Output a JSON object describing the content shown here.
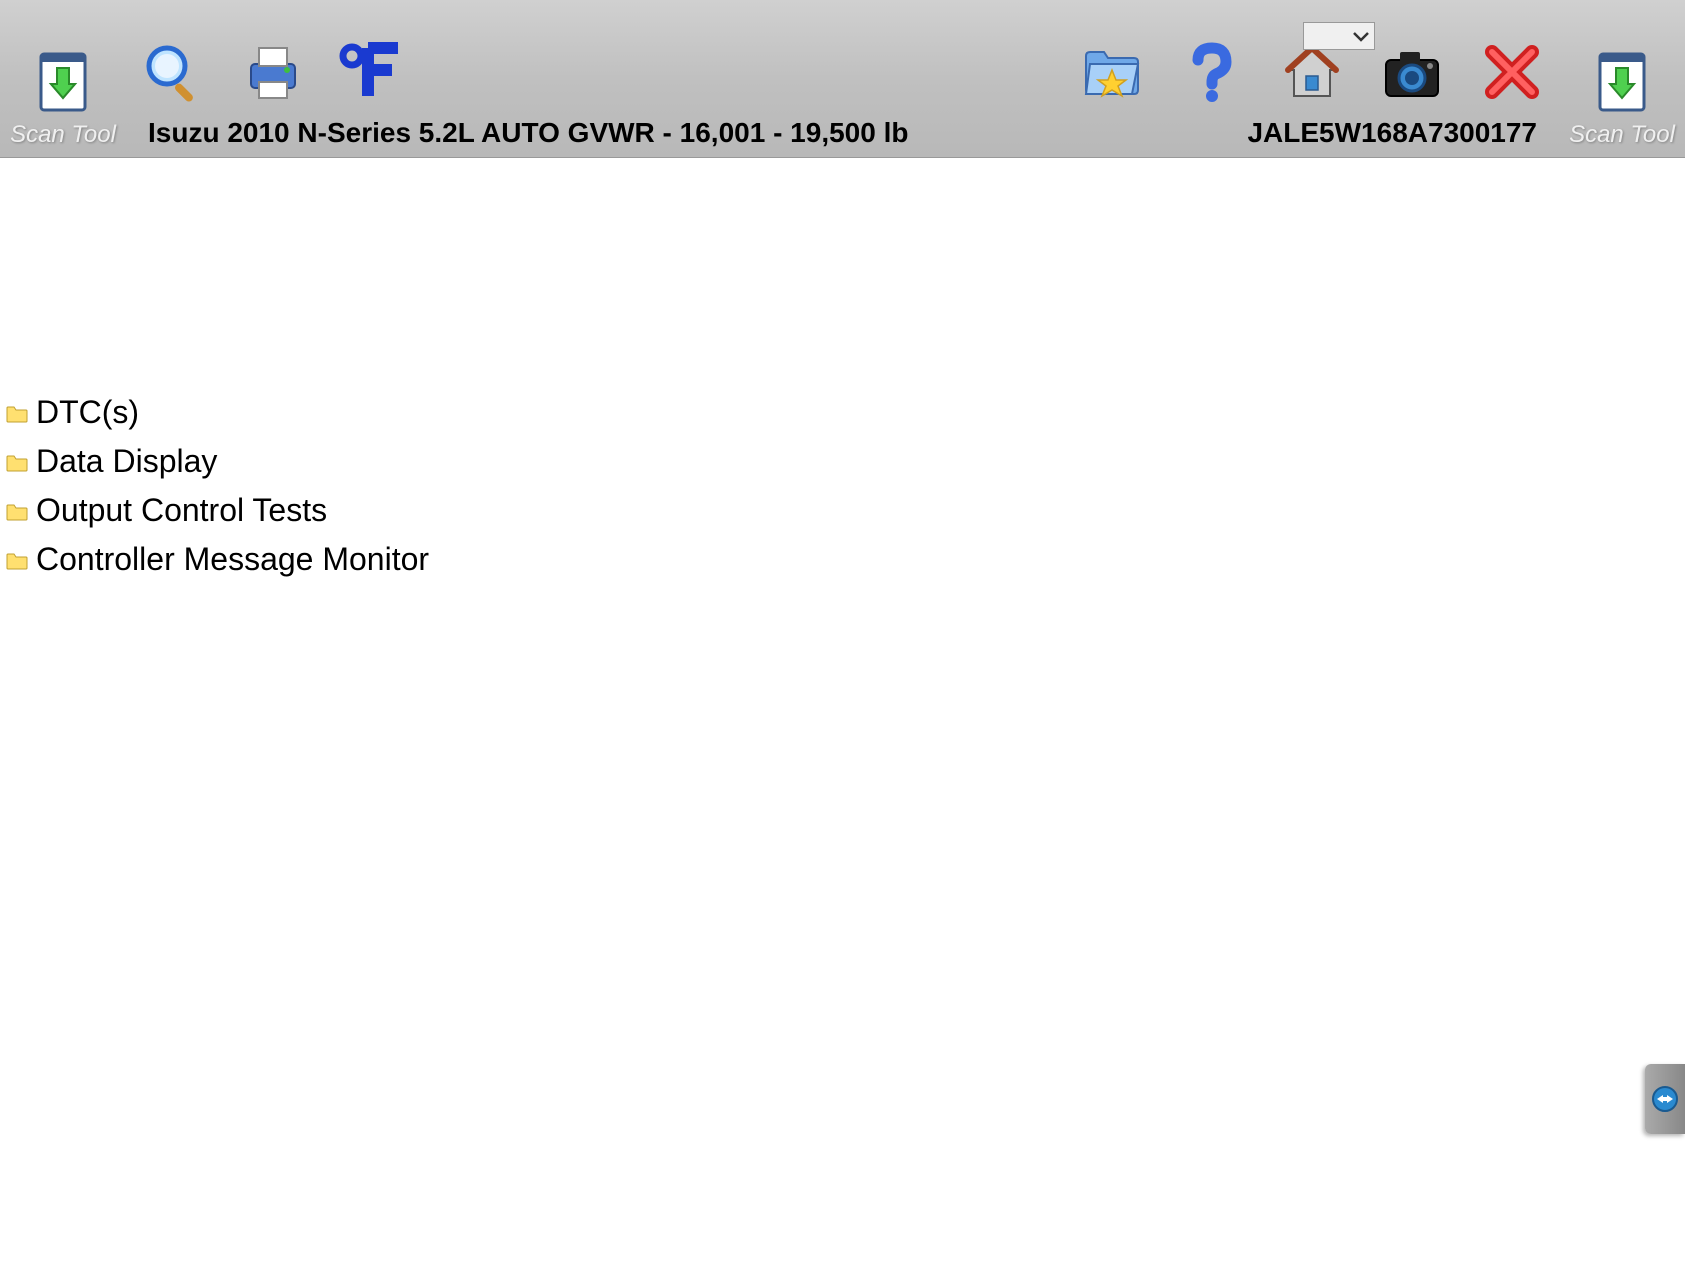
{
  "toolbar": {
    "left_label": "Scan Tool",
    "right_label": "Scan Tool",
    "vehicle_info": "Isuzu  2010  N-Series  5.2L  AUTO GVWR - 16,001 - 19,500 lb",
    "vin": "JALE5W168A7300177"
  },
  "menu": {
    "items": [
      {
        "label": "DTC(s)"
      },
      {
        "label": "Data Display"
      },
      {
        "label": "Output Control Tests"
      },
      {
        "label": "Controller Message Monitor"
      }
    ]
  }
}
